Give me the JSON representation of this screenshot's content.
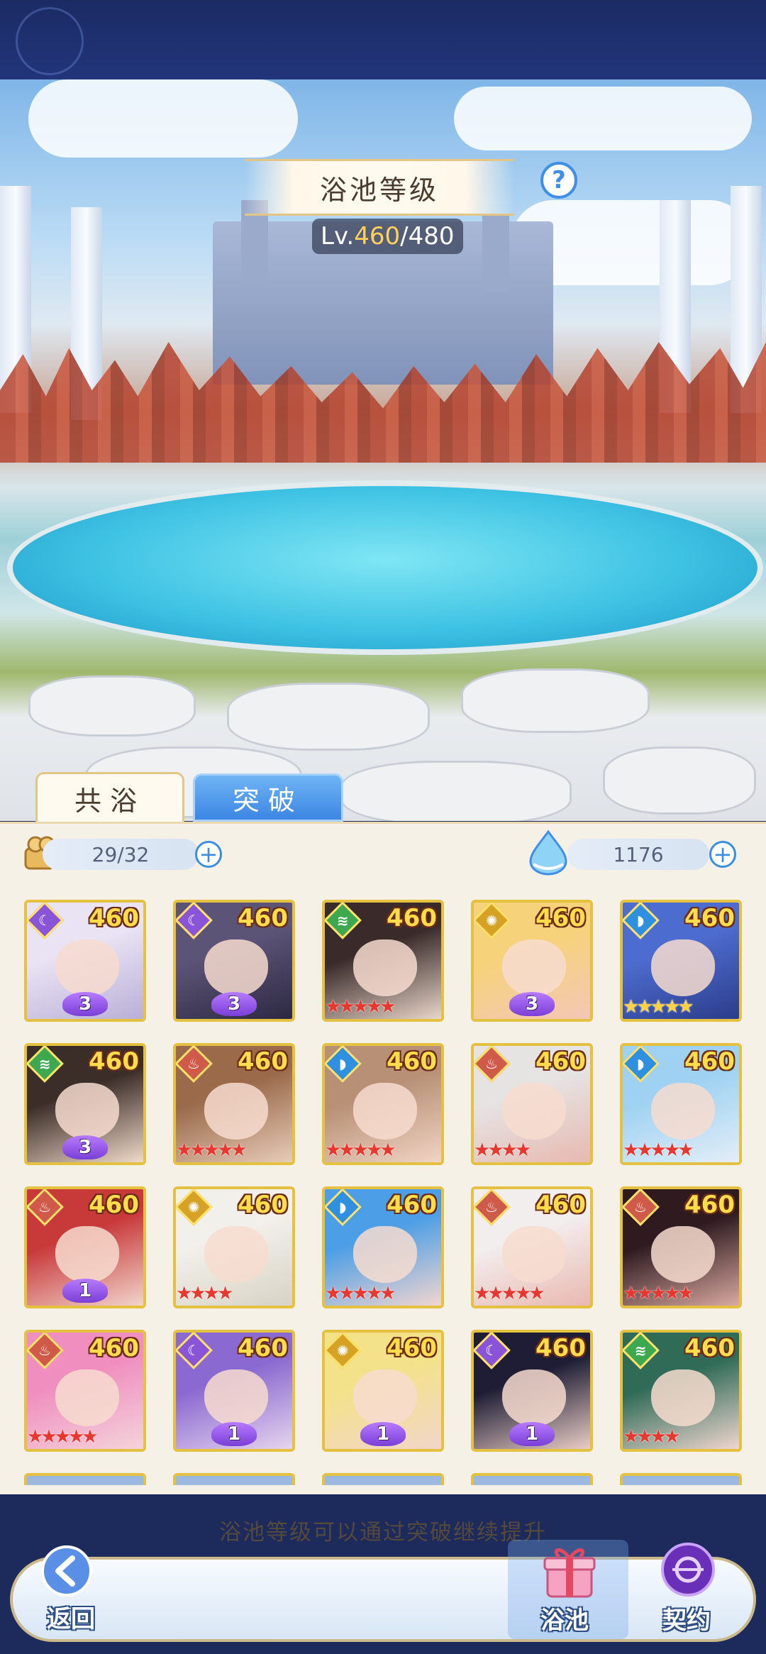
{
  "header": {
    "title": "浴池等级",
    "level_current": "460",
    "level_sep": "/",
    "level_max": "480",
    "level_prefix": "Lv."
  },
  "tabs": [
    {
      "label": "共浴",
      "active": true
    },
    {
      "label": "突破",
      "active": false
    }
  ],
  "resources": {
    "left_value": "29/32",
    "right_value": "1176"
  },
  "icons": {
    "help": "?",
    "plus": "+"
  },
  "colors": {
    "water": "#bf9b6e",
    "fire": "#d05a4a",
    "wind": "#3da84f",
    "moon": "#8a54d8",
    "sun": "#d6a226",
    "drop": "#2f8fe0"
  },
  "cards": [
    {
      "level": "460",
      "element": "moon",
      "badge": "3",
      "stars": 0,
      "tint": [
        "#e9e3f4",
        "#b9b0d6"
      ]
    },
    {
      "level": "460",
      "element": "moon",
      "badge": "3",
      "stars": 0,
      "tint": [
        "#5c5477",
        "#2d2942"
      ]
    },
    {
      "level": "460",
      "element": "wind",
      "badge": "",
      "stars": 5,
      "tint": [
        "#3a2a2a",
        "#e8d6c8"
      ]
    },
    {
      "level": "460",
      "element": "sun",
      "badge": "3",
      "stars": 0,
      "tint": [
        "#f6d37a",
        "#f3c7b6"
      ]
    },
    {
      "level": "460",
      "element": "drop",
      "badge": "",
      "stars": 5,
      "tint": [
        "#4d6ccf",
        "#2b3d8a"
      ]
    },
    {
      "level": "460",
      "element": "wind",
      "badge": "3",
      "stars": 0,
      "tint": [
        "#3b2d28",
        "#f0d9c9"
      ]
    },
    {
      "level": "460",
      "element": "fire",
      "badge": "",
      "stars": 5,
      "tint": [
        "#9a6a4a",
        "#e7cbb8"
      ]
    },
    {
      "level": "460",
      "element": "drop",
      "badge": "",
      "stars": 5,
      "tint": [
        "#b79075",
        "#f1d4c4"
      ]
    },
    {
      "level": "460",
      "element": "fire",
      "badge": "",
      "stars": 4,
      "tint": [
        "#e6e3e3",
        "#e7b9b0"
      ]
    },
    {
      "level": "460",
      "element": "drop",
      "badge": "",
      "stars": 5,
      "tint": [
        "#9fd2f2",
        "#e3eef8"
      ]
    },
    {
      "level": "460",
      "element": "fire",
      "badge": "1",
      "stars": 0,
      "tint": [
        "#c8393a",
        "#f2d4cb"
      ]
    },
    {
      "level": "460",
      "element": "sun",
      "badge": "",
      "stars": 4,
      "tint": [
        "#f2f0ea",
        "#d8d3c6"
      ]
    },
    {
      "level": "460",
      "element": "drop",
      "badge": "",
      "stars": 5,
      "tint": [
        "#4c9ee6",
        "#f2d6cf"
      ]
    },
    {
      "level": "460",
      "element": "fire",
      "badge": "",
      "stars": 5,
      "tint": [
        "#f3eeee",
        "#e9b8b0"
      ]
    },
    {
      "level": "460",
      "element": "fire",
      "badge": "",
      "stars": 5,
      "tint": [
        "#2e1a1f",
        "#d9a9a0"
      ]
    },
    {
      "level": "460",
      "element": "fire",
      "badge": "",
      "stars": 5,
      "tint": [
        "#f08fbf",
        "#f4d3da"
      ]
    },
    {
      "level": "460",
      "element": "moon",
      "badge": "1",
      "stars": 0,
      "tint": [
        "#8a6ad0",
        "#e5d4ee"
      ]
    },
    {
      "level": "460",
      "element": "sun",
      "badge": "1",
      "stars": 0,
      "tint": [
        "#f4e28a",
        "#f2d6c8"
      ]
    },
    {
      "level": "460",
      "element": "moon",
      "badge": "1",
      "stars": 0,
      "tint": [
        "#1e1d35",
        "#e9cdc4"
      ]
    },
    {
      "level": "460",
      "element": "wind",
      "badge": "",
      "stars": 4,
      "tint": [
        "#2f6b57",
        "#f0d6cf"
      ]
    }
  ],
  "hint": "浴池等级可以通过突破继续提升",
  "footer": {
    "back": "返回",
    "bath": "浴池",
    "contract": "契约"
  }
}
